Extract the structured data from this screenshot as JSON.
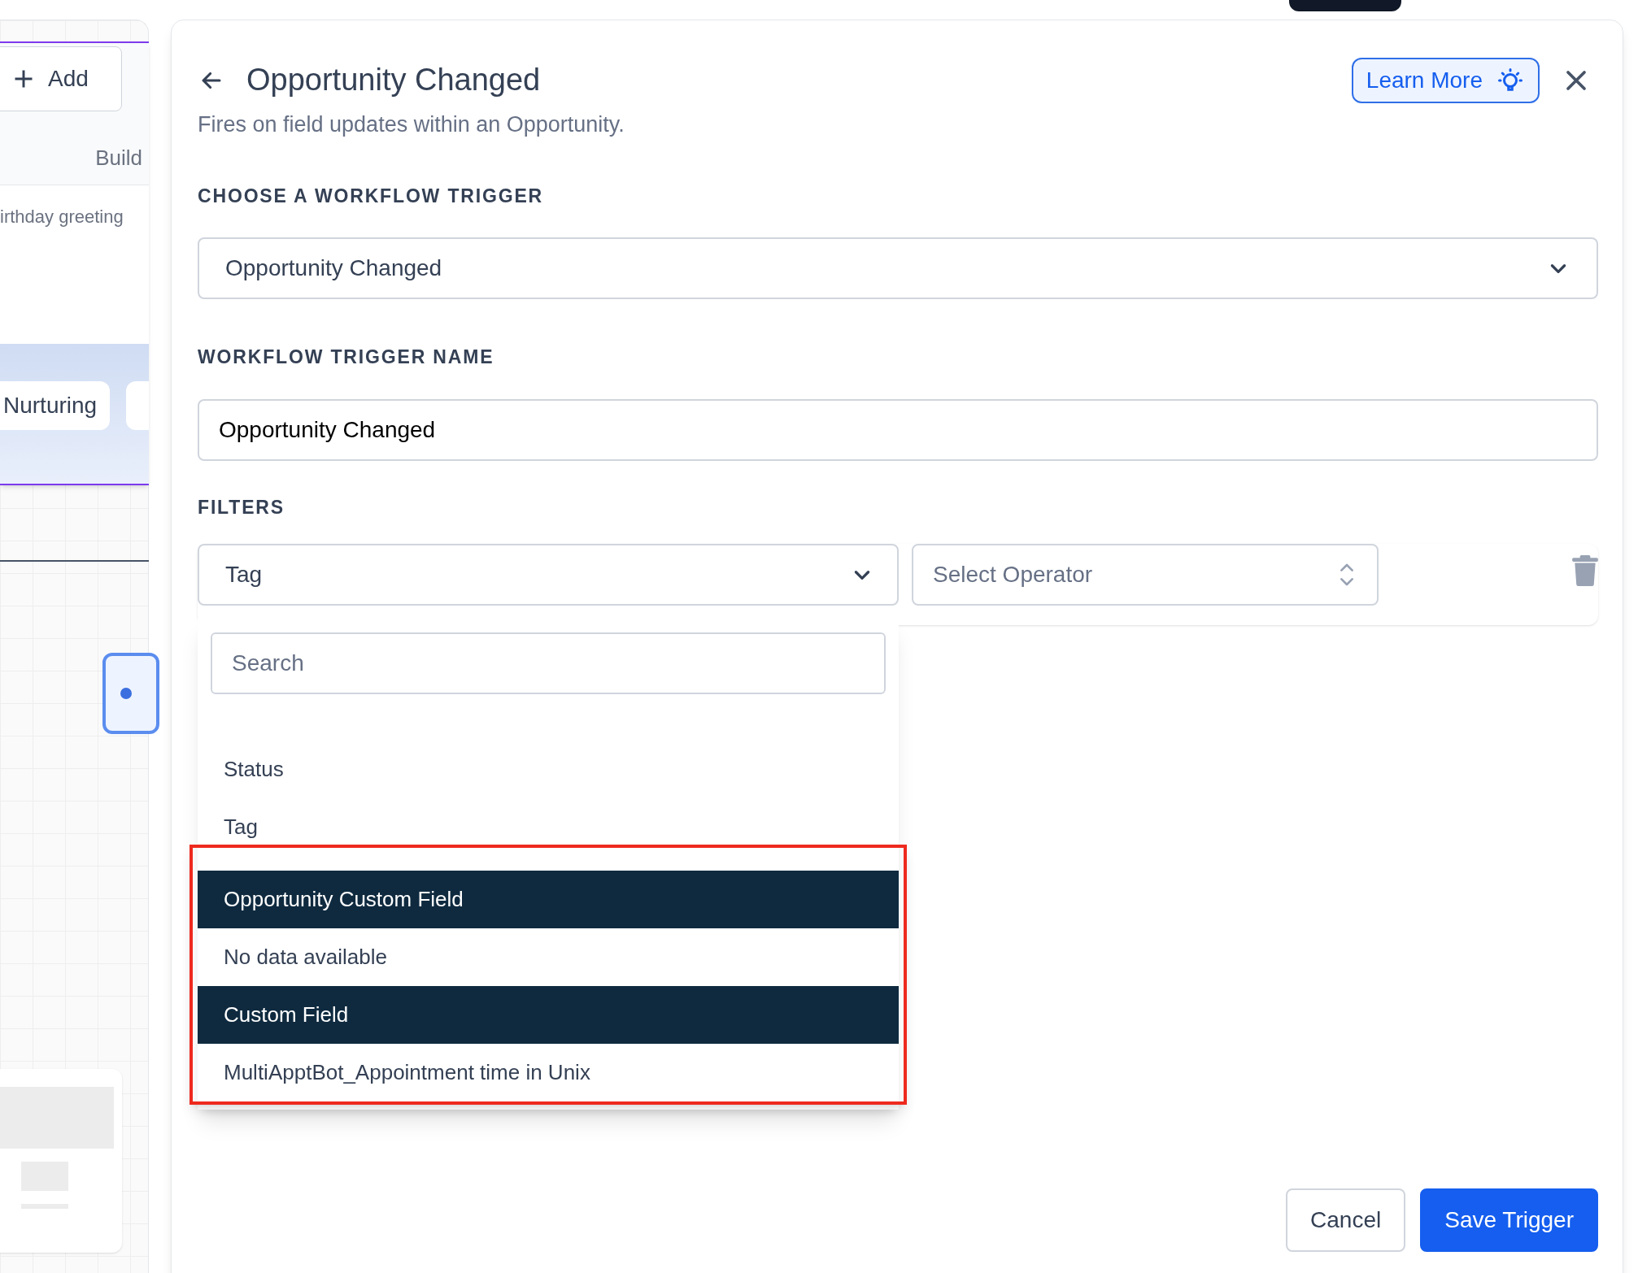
{
  "canvas": {
    "add_button": "Add",
    "subtitle": "Build",
    "description": "irthday greeting",
    "chips": [
      "Nurturing"
    ]
  },
  "panel": {
    "title": "Opportunity Changed",
    "subtitle": "Fires on field updates within an Opportunity.",
    "learn_more": "Learn More",
    "trigger_section": {
      "label": "CHOOSE A WORKFLOW TRIGGER",
      "value": "Opportunity Changed"
    },
    "name_section": {
      "label": "WORKFLOW TRIGGER NAME",
      "value": "Opportunity Changed"
    },
    "filters": {
      "label": "FILTERS",
      "field": {
        "value": "Tag",
        "expanded": true
      },
      "operator": {
        "placeholder": "Select Operator"
      }
    },
    "dropdown": {
      "search_placeholder": "Search",
      "items": [
        {
          "kind": "option",
          "label": "Status"
        },
        {
          "kind": "option",
          "label": "Tag"
        }
      ],
      "highlighted_items": [
        {
          "kind": "group",
          "label": "Opportunity Custom Field"
        },
        {
          "kind": "empty",
          "label": "No data available"
        },
        {
          "kind": "group",
          "label": "Custom Field"
        },
        {
          "kind": "option",
          "label": "MultiApptBot_Appointment time in Unix"
        }
      ]
    },
    "buttons": [
      {
        "kind": "secondary",
        "label": "Cancel"
      },
      {
        "kind": "primary",
        "label": "Save Trigger"
      }
    ]
  }
}
